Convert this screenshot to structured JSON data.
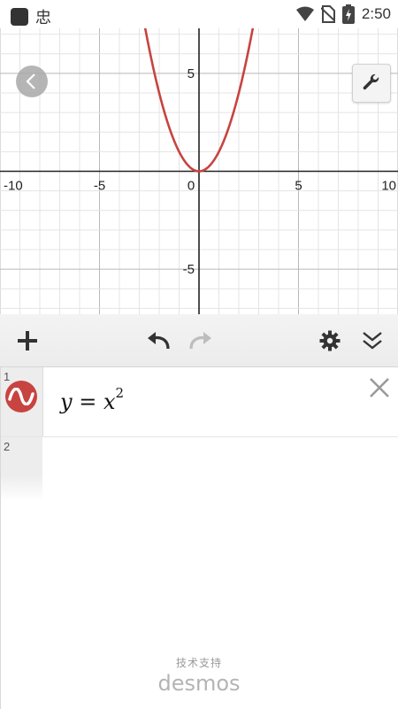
{
  "status_bar": {
    "app_glyph": "忠",
    "time": "2:50"
  },
  "graph": {
    "x_tick_labels": [
      "-10",
      "-5",
      "0",
      "5",
      "10"
    ],
    "y_tick_labels": [
      "5",
      "-5"
    ],
    "curve_color": "#c74440"
  },
  "toolbar": {
    "add_icon": "plus-icon",
    "undo_icon": "undo-icon",
    "redo_icon": "redo-icon",
    "settings_icon": "gear-icon",
    "collapse_icon": "double-chevron-down-icon"
  },
  "expressions": [
    {
      "index": "1",
      "lhs": "y",
      "eq": "=",
      "rhs": "x",
      "exp": "2",
      "color": "#c74440"
    },
    {
      "index": "2"
    }
  ],
  "footer": {
    "powered_by": "技术支持",
    "brand": "desmos"
  },
  "chart_data": {
    "type": "line",
    "series": [
      {
        "expression": "y = x^2",
        "x": [
          -2.6,
          -2,
          -1.5,
          -1,
          -0.5,
          0,
          0.5,
          1,
          1.5,
          2,
          2.6
        ],
        "y": [
          6.76,
          4,
          2.25,
          1,
          0.25,
          0,
          0.25,
          1,
          2.25,
          4,
          6.76
        ]
      }
    ],
    "xlim": [
      -10,
      10
    ],
    "ylim": [
      -7.3,
      7.3
    ],
    "x_ticks": [
      -10,
      -5,
      0,
      5,
      10
    ],
    "y_ticks": [
      -5,
      5
    ],
    "grid": true
  }
}
